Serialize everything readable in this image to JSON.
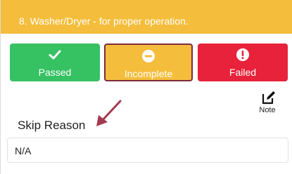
{
  "header": {
    "title": "8. Washer/Dryer -  for proper operation."
  },
  "status_buttons": [
    {
      "label": "Passed",
      "icon": "check-icon",
      "color": "#36c163",
      "selected": false
    },
    {
      "label": "Incomplete",
      "icon": "minus-circle-icon",
      "color": "#f4bd3b",
      "selected": true
    },
    {
      "label": "Failed",
      "icon": "exclamation-circle-icon",
      "color": "#e8223a",
      "selected": false
    }
  ],
  "note": {
    "label": "Note",
    "icon": "edit-icon"
  },
  "skip_reason": {
    "label": "Skip Reason",
    "value": "N/A"
  },
  "colors": {
    "header_bg": "#f4bd3b",
    "selected_border": "#7d2b3d",
    "annotation_arrow": "#a33a4f"
  }
}
